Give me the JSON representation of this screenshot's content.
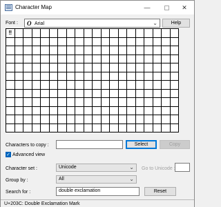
{
  "window": {
    "title": "Character Map",
    "minimize_glyph": "—",
    "close_glyph": "✕"
  },
  "font_row": {
    "label": "Font :",
    "icon": "opentype-font-icon",
    "icon_glyph": "O",
    "value": "Arial",
    "help_label": "Help"
  },
  "grid": {
    "columns": 20,
    "rows": 12,
    "selected_glyph": "‼"
  },
  "copy_row": {
    "label": "Characters to copy :",
    "value": "",
    "select_label": "Select",
    "copy_label": "Copy"
  },
  "advanced_view": {
    "label": "Advanced view",
    "checked": true,
    "check_glyph": "✓"
  },
  "character_set": {
    "label": "Character set :",
    "value": "Unicode",
    "goto_label": "Go to Unicode :",
    "goto_value": ""
  },
  "group_by": {
    "label": "Group by :",
    "value": "All"
  },
  "search": {
    "label": "Search for :",
    "value": "double exclamation",
    "reset_label": "Reset"
  },
  "status": {
    "text": "U+203C: Double Exclamation Mark"
  },
  "dropdown_arrow": "⌄"
}
